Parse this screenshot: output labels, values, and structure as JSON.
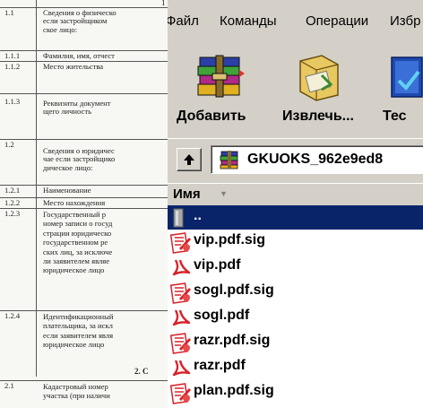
{
  "document": {
    "top_fragment": "1",
    "rows": [
      {
        "num": "1.1",
        "text": "Сведения о физическо\nесли застройщиком\nское лицо:"
      },
      {
        "num": "1.1.1",
        "text": "Фамилия, имя, отчест"
      },
      {
        "num": "1.1.2",
        "text": "Место жительства"
      },
      {
        "num": "1.1.3",
        "text": "Реквизиты документ\nщего личность"
      },
      {
        "num": "1.2",
        "text": "Сведения о юридичес\nчае если застройщико\nдическое лицо:"
      },
      {
        "num": "1.2.1",
        "text": "Наименование"
      },
      {
        "num": "1.2.2",
        "text": "Место нахождения"
      },
      {
        "num": "1.2.3",
        "text": "Государственный р\nномер записи о госуд\nстрации юридическо\nгосударственном ре\nских лиц, за исключе\nли заявителем являе\nюридическое лицо"
      },
      {
        "num": "1.2.4",
        "text": "Идентификационный\nплательщика, за искл\nесли заявителем явля\nюридическое лицо"
      },
      {
        "num": "2.1",
        "text": "Кадастровый номер\nучастка (при наличи"
      }
    ],
    "section2": "2. С"
  },
  "menu": {
    "items": [
      "Файл",
      "Команды",
      "Операции",
      "Избр"
    ]
  },
  "toolbar": {
    "add_label": "Добавить",
    "extract_label": "Извлечь...",
    "test_label": "Тес"
  },
  "address": {
    "path": "GKUOKS_962e9ed8"
  },
  "columns": {
    "name_header": "Имя"
  },
  "files": [
    {
      "name": "..",
      "type": "parent"
    },
    {
      "name": "vip.pdf.sig",
      "type": "sig"
    },
    {
      "name": "vip.pdf",
      "type": "pdf"
    },
    {
      "name": "sogl.pdf.sig",
      "type": "sig"
    },
    {
      "name": "sogl.pdf",
      "type": "pdf"
    },
    {
      "name": "razr.pdf.sig",
      "type": "sig"
    },
    {
      "name": "razr.pdf",
      "type": "pdf"
    },
    {
      "name": "plan.pdf.sig",
      "type": "sig"
    }
  ],
  "colors": {
    "window_bg": "#d4d0c8",
    "selection": "#0a246a",
    "pdf_red": "#d8232a"
  }
}
